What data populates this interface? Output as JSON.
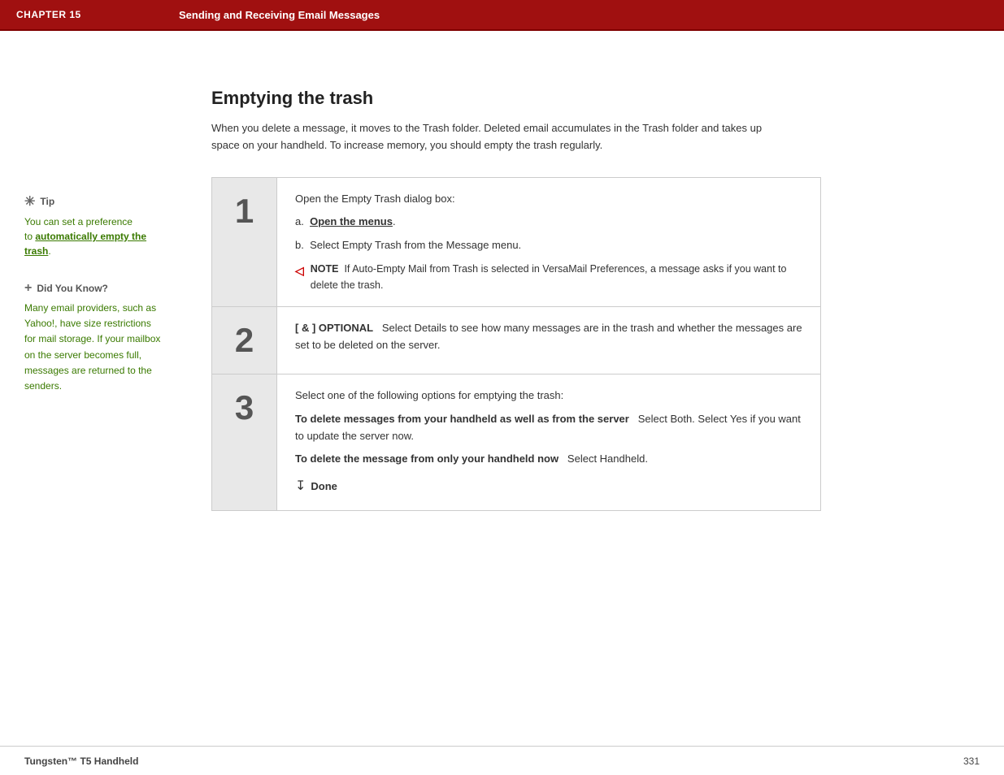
{
  "header": {
    "chapter": "CHAPTER 15",
    "title": "Sending and Receiving Email Messages"
  },
  "sidebar": {
    "tip": {
      "icon": "✳",
      "label": "Tip",
      "line1": "You can set a preference",
      "line2": "to ",
      "link_text": "automatically empty the trash",
      "line3": "."
    },
    "did_you_know": {
      "icon": "+",
      "label": "Did You Know?",
      "text": "Many email providers, such as Yahoo!, have size restrictions for mail storage. If your mailbox on the server becomes full, messages are returned to the senders."
    }
  },
  "main": {
    "section_title": "Emptying the trash",
    "intro": "When you delete a message, it moves to the Trash folder. Deleted email accumulates in the Trash folder and takes up space on your handheld. To increase memory, you should empty the trash regularly.",
    "steps": [
      {
        "number": "1",
        "content_parts": [
          {
            "type": "text",
            "text": "Open the Empty Trash dialog box:"
          },
          {
            "type": "sub",
            "label": "a.",
            "text": "Open the menus",
            "link": true
          },
          {
            "type": "sub",
            "label": "b.",
            "text": "Select Empty Trash from the Message menu."
          },
          {
            "type": "note",
            "icon": "N",
            "label": "NOTE",
            "text": "If Auto-Empty Mail from Trash is selected in VersaMail Preferences, a message asks if you want to delete the trash."
          }
        ]
      },
      {
        "number": "2",
        "content_parts": [
          {
            "type": "optional",
            "label": "[ & ] OPTIONAL",
            "text": "Select Details to see how many messages are in the trash and whether the messages are set to be deleted on the server."
          }
        ]
      },
      {
        "number": "3",
        "content_parts": [
          {
            "type": "text",
            "text": "Select one of the following options for emptying the trash:"
          },
          {
            "type": "bold_inline",
            "bold": "To delete messages from your handheld as well as from the server",
            "text": "   Select Both. Select Yes if you want to update the server now."
          },
          {
            "type": "bold_inline",
            "bold": "To delete the message from only your handheld now",
            "text": "   Select Handheld."
          },
          {
            "type": "done"
          }
        ]
      }
    ]
  },
  "footer": {
    "brand_italic": "Tungsten™ ",
    "brand_bold": "T5",
    "brand_rest": " Handheld",
    "page_number": "331"
  }
}
